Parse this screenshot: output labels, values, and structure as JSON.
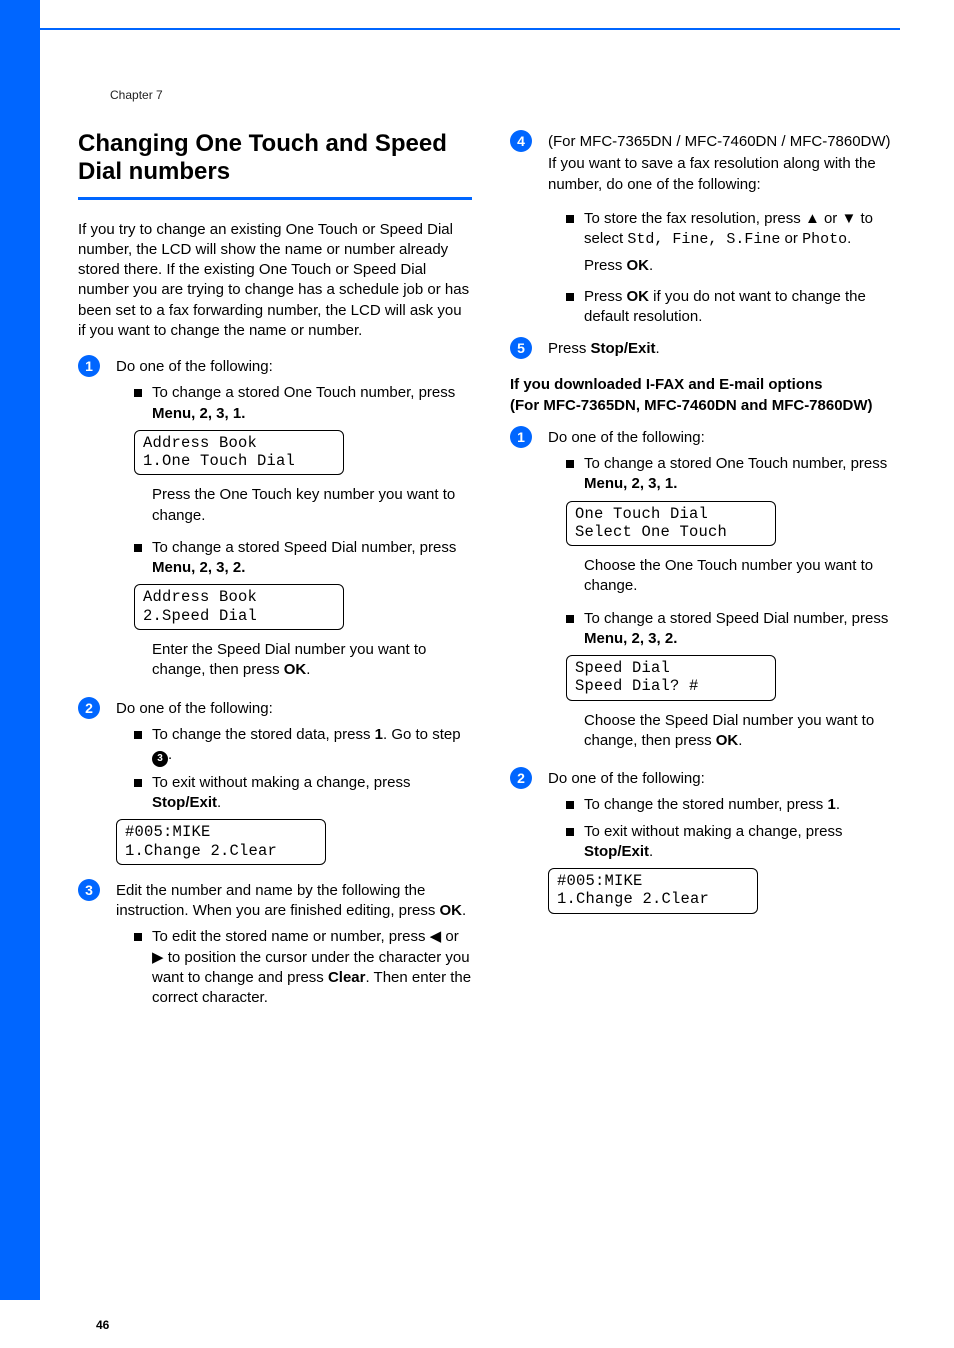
{
  "chapter": "Chapter 7",
  "heading": "Changing One Touch and Speed Dial numbers",
  "intro": "If you try to change an existing One Touch or Speed Dial number, the LCD will show the name or number already stored there. If the existing One Touch or Speed Dial number you are trying to change has a schedule job or has been set to a fax forwarding number, the LCD will ask you if you want to change the name or number.",
  "left": {
    "step1": {
      "lead": "Do one of the following:",
      "b1_pre": "To change a stored One Touch number, press ",
      "b1_menu": "Menu",
      "b1_seq": ", 2, 3, 1.",
      "lcd1_l1": "Address Book",
      "lcd1_l2": "1.One Touch Dial",
      "under1": "Press the One Touch key number you want to change.",
      "b2_pre": "To change a stored Speed Dial number, press ",
      "b2_menu": "Menu",
      "b2_seq": ", 2, 3, 2.",
      "lcd2_l1": "Address Book",
      "lcd2_l2": "2.Speed Dial",
      "under2_pre": "Enter the Speed Dial number you want to change, then press ",
      "under2_ok": "OK",
      "under2_post": "."
    },
    "step2": {
      "lead": "Do one of the following:",
      "b1_pre": "To change the stored data, press ",
      "b1_key": "1",
      "b1_post": ". Go to step ",
      "goto": "3",
      "goto_post": ".",
      "b2_pre": "To exit without making a change, press ",
      "b2_key": "Stop/Exit",
      "b2_post": ".",
      "lcd_l1": "#005:MIKE",
      "lcd_l2": "1.Change 2.Clear"
    },
    "step3": {
      "lead_pre": "Edit the number and name by the following the instruction. When you are finished editing, press ",
      "lead_ok": "OK",
      "lead_post": ".",
      "b1_pre": "To edit the stored name or number, press ",
      "arrows": "◀ or ▶",
      "b1_mid": " to position the cursor under the character you want to change and press ",
      "b1_clear": "Clear",
      "b1_post": ". Then enter the correct character."
    }
  },
  "right": {
    "step4": {
      "models": "(For MFC-7365DN /  MFC-7460DN / MFC-7860DW)",
      "intro": "If you want to save a fax resolution along with the number, do one of the following:",
      "b1_pre": "To store the fax resolution, press ",
      "arrows": "▲ or ▼",
      "b1_mid": " to select ",
      "opts": "Std, Fine, S.Fine",
      "b1_or": " or ",
      "opt_last": "Photo",
      "b1_post": ".",
      "press_ok_pre": "Press ",
      "press_ok": "OK",
      "press_ok_post": ".",
      "b2_pre": "Press ",
      "b2_ok": "OK",
      "b2_post": " if you do not want to change the default resolution."
    },
    "step5": {
      "lead_pre": "Press ",
      "lead_key": "Stop/Exit",
      "lead_post": "."
    },
    "ifax_head1": "If you downloaded I-FAX and E-mail options",
    "ifax_head2": "(For MFC-7365DN, MFC-7460DN and MFC-7860DW)",
    "bstep1": {
      "lead": "Do one of the following:",
      "b1_pre": "To change a stored One Touch number, press ",
      "b1_menu": "Menu",
      "b1_seq": ", 2, 3, 1.",
      "lcd1_l1": "One Touch Dial",
      "lcd1_l2": "Select One Touch",
      "under1": "Choose the One Touch number you want to change.",
      "b2_pre": "To change a stored Speed Dial number, press ",
      "b2_menu": "Menu",
      "b2_seq": ", 2, 3, 2.",
      "lcd2_l1": "Speed Dial",
      "lcd2_l2": "Speed Dial? #",
      "under2_pre": "Choose the Speed Dial number you want to change, then press ",
      "under2_ok": "OK",
      "under2_post": "."
    },
    "bstep2": {
      "lead": "Do one of the following:",
      "b1_pre": "To change the stored number, press ",
      "b1_key": "1",
      "b1_post": ".",
      "b2_pre": "To exit without making a change, press ",
      "b2_key": "Stop/Exit",
      "b2_post": ".",
      "lcd_l1": "#005:MIKE",
      "lcd_l2": "1.Change 2.Clear"
    }
  },
  "page_number": "46"
}
